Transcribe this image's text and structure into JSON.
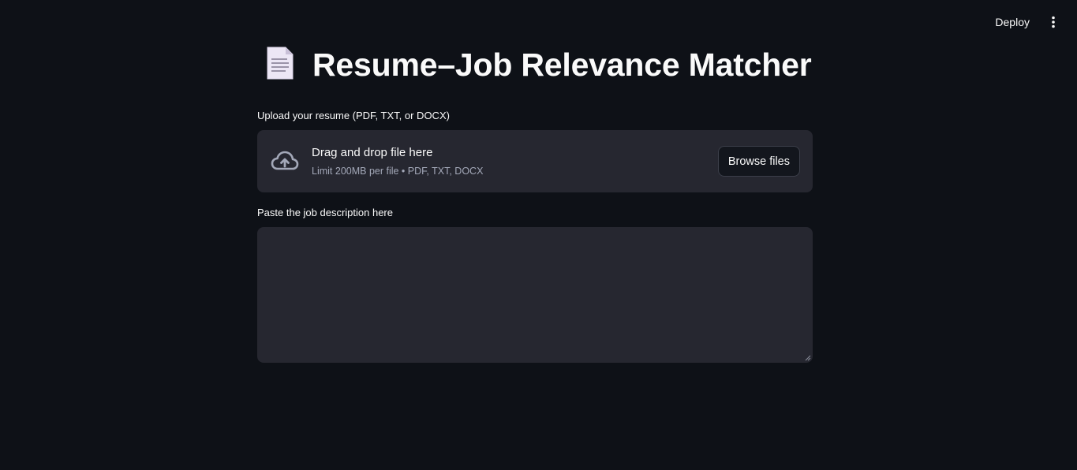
{
  "toolbar": {
    "deploy_label": "Deploy",
    "menu_icon": "more-vertical-icon"
  },
  "page": {
    "title_icon": "page-facing-up-icon",
    "title": "Resume–Job Relevance Matcher"
  },
  "uploader": {
    "label": "Upload your resume (PDF, TXT, or DOCX)",
    "icon": "cloud-upload-icon",
    "drag_text": "Drag and drop file here",
    "limit_text": "Limit 200MB per file • PDF, TXT, DOCX",
    "browse_label": "Browse files"
  },
  "job_description": {
    "label": "Paste the job description here",
    "value": "",
    "placeholder": ""
  },
  "colors": {
    "background": "#0e1117",
    "surface": "#262730",
    "text": "#fafafa",
    "muted_text": "#a3a8b8"
  }
}
